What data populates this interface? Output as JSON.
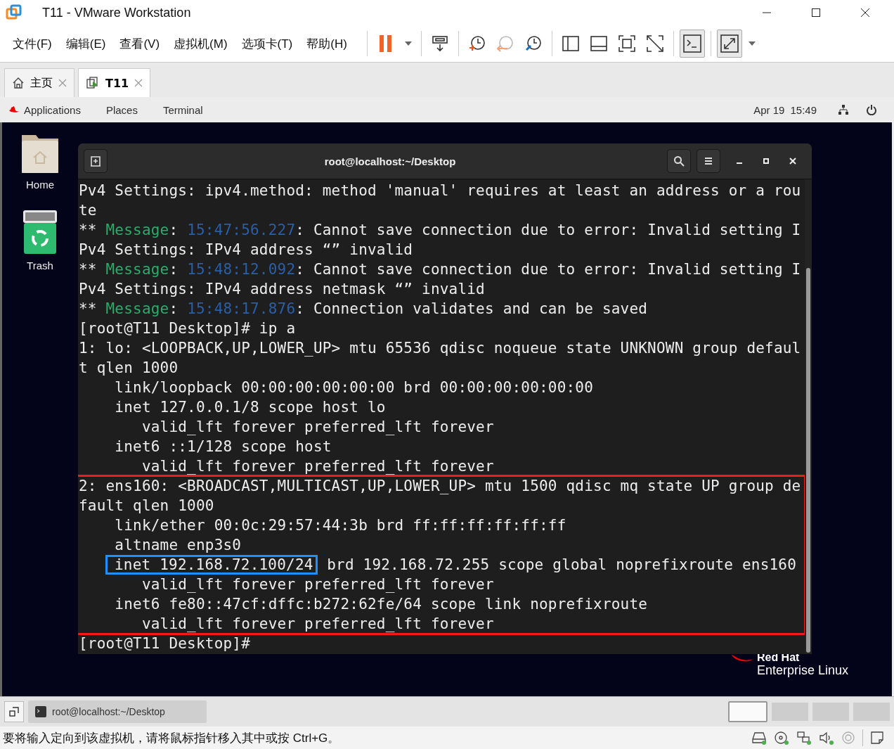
{
  "window": {
    "title": "T11 - VMware Workstation"
  },
  "menu": [
    "文件(F)",
    "编辑(E)",
    "查看(V)",
    "虚拟机(M)",
    "选项卡(T)",
    "帮助(H)"
  ],
  "toolbar": {
    "groups": [
      [
        {
          "kind": "pause",
          "pressed": false
        },
        {
          "kind": "caret",
          "pressed": false
        }
      ],
      [
        {
          "kind": "send-keys",
          "pressed": false
        }
      ],
      [
        {
          "kind": "snapshot",
          "pressed": false
        },
        {
          "kind": "revert",
          "pressed": false
        },
        {
          "kind": "manager",
          "pressed": false
        }
      ],
      [
        {
          "kind": "sidebar",
          "pressed": false
        },
        {
          "kind": "thumbbar",
          "pressed": false
        },
        {
          "kind": "fit",
          "pressed": false
        },
        {
          "kind": "unity",
          "pressed": false
        }
      ],
      [
        {
          "kind": "console",
          "pressed": true
        }
      ],
      [
        {
          "kind": "stretch",
          "pressed": true
        },
        {
          "kind": "caret",
          "pressed": false
        }
      ]
    ]
  },
  "tabs": [
    {
      "label": "主页",
      "kind": "home",
      "selected": false
    },
    {
      "label": "T11",
      "kind": "vm",
      "selected": true
    }
  ],
  "guest_topbar": {
    "menus": [
      "Applications",
      "Places",
      "Terminal"
    ],
    "date": "Apr 19",
    "time": "15:49"
  },
  "desktop_icons": [
    {
      "label": "Home",
      "kind": "folder"
    },
    {
      "label": "Trash",
      "kind": "trash"
    }
  ],
  "terminal": {
    "title": "root@localhost:~/Desktop",
    "blocks": [
      {
        "outlined": false,
        "lines": [
          {
            "segments": [
              {
                "kind": "plain",
                "text": "Pv4 Settings: ipv4.method: method 'manual' requires at least an address or a rou"
              }
            ]
          },
          {
            "segments": [
              {
                "kind": "plain",
                "text": "te"
              }
            ]
          },
          {
            "segments": [
              {
                "kind": "plain",
                "text": "** "
              },
              {
                "kind": "label",
                "text": "Message"
              },
              {
                "kind": "plain",
                "text": ": "
              },
              {
                "kind": "time",
                "text": "15:47:56.227"
              },
              {
                "kind": "plain",
                "text": ": Cannot save connection due to error: Invalid setting I"
              }
            ]
          },
          {
            "segments": [
              {
                "kind": "plain",
                "text": "Pv4 Settings: IPv4 address “” invalid"
              }
            ]
          },
          {
            "segments": [
              {
                "kind": "plain",
                "text": "** "
              },
              {
                "kind": "label",
                "text": "Message"
              },
              {
                "kind": "plain",
                "text": ": "
              },
              {
                "kind": "time",
                "text": "15:48:12.092"
              },
              {
                "kind": "plain",
                "text": ": Cannot save connection due to error: Invalid setting I"
              }
            ]
          },
          {
            "segments": [
              {
                "kind": "plain",
                "text": "Pv4 Settings: IPv4 address netmask “” invalid"
              }
            ]
          },
          {
            "segments": [
              {
                "kind": "plain",
                "text": "** "
              },
              {
                "kind": "label",
                "text": "Message"
              },
              {
                "kind": "plain",
                "text": ": "
              },
              {
                "kind": "time",
                "text": "15:48:17.876"
              },
              {
                "kind": "plain",
                "text": ": Connection validates and can be saved"
              }
            ]
          },
          {
            "segments": [
              {
                "kind": "plain",
                "text": "[root@T11 Desktop]# ip a"
              }
            ]
          },
          {
            "segments": [
              {
                "kind": "plain",
                "text": "1: lo: <LOOPBACK,UP,LOWER_UP> mtu 65536 qdisc noqueue state UNKNOWN group defaul"
              }
            ]
          },
          {
            "segments": [
              {
                "kind": "plain",
                "text": "t qlen 1000"
              }
            ]
          },
          {
            "segments": [
              {
                "kind": "plain",
                "text": "    link/loopback 00:00:00:00:00:00 brd 00:00:00:00:00:00"
              }
            ]
          },
          {
            "segments": [
              {
                "kind": "plain",
                "text": "    inet 127.0.0.1/8 scope host lo"
              }
            ]
          },
          {
            "segments": [
              {
                "kind": "plain",
                "text": "       valid_lft forever preferred_lft forever"
              }
            ]
          },
          {
            "segments": [
              {
                "kind": "plain",
                "text": "    inet6 ::1/128 scope host"
              }
            ]
          },
          {
            "segments": [
              {
                "kind": "plain",
                "text": "       valid_lft forever preferred_lft forever"
              }
            ]
          }
        ]
      },
      {
        "outlined": true,
        "lines": [
          {
            "segments": [
              {
                "kind": "plain",
                "text": "2: ens160: <BROADCAST,MULTICAST,UP,LOWER_UP> mtu 1500 qdisc mq state UP group de"
              }
            ]
          },
          {
            "segments": [
              {
                "kind": "plain",
                "text": "fault qlen 1000"
              }
            ]
          },
          {
            "segments": [
              {
                "kind": "plain",
                "text": "    link/ether 00:0c:29:57:44:3b brd ff:ff:ff:ff:ff:ff"
              }
            ]
          },
          {
            "segments": [
              {
                "kind": "plain",
                "text": "    altname enp3s0"
              }
            ]
          },
          {
            "segments": [
              {
                "kind": "boxed",
                "text": "inet 192.168.72.100/24"
              },
              {
                "kind": "plain",
                "text": " brd 192.168.72.255 scope global noprefixroute ens160"
              }
            ]
          },
          {
            "segments": [
              {
                "kind": "plain",
                "text": "       valid_lft forever preferred_lft forever"
              }
            ]
          },
          {
            "segments": [
              {
                "kind": "plain",
                "text": "    inet6 fe80::47cf:dffc:b272:62fe/64 scope link noprefixroute"
              }
            ]
          },
          {
            "segments": [
              {
                "kind": "plain",
                "text": "       valid_lft forever preferred_lft forever"
              }
            ]
          }
        ]
      },
      {
        "outlined": false,
        "lines": [
          {
            "segments": [
              {
                "kind": "plain",
                "text": "[root@T11 Desktop]#"
              }
            ]
          }
        ]
      }
    ]
  },
  "branding": {
    "top": "Red Hat",
    "bottom": "Enterprise Linux"
  },
  "taskbar": {
    "window": "root@localhost:~/Desktop",
    "workspaces": [
      {
        "selected": true
      },
      {
        "selected": false
      },
      {
        "selected": false
      },
      {
        "selected": false
      }
    ]
  },
  "status_bar": {
    "message": "要将输入定向到该虚拟机，请将鼠标指针移入其中或按 Ctrl+G。"
  }
}
